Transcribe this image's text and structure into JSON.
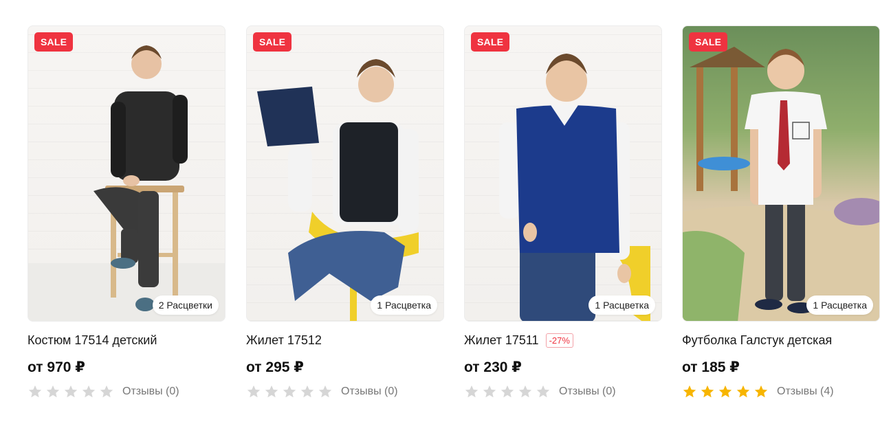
{
  "colors": {
    "sale": "#ef3340",
    "star_filled": "#f7b500",
    "star_empty": "#d6d6d6"
  },
  "products": [
    {
      "badge": "SALE",
      "colors_label": "2 Расцветки",
      "title": "Костюм 17514 детский",
      "discount": "",
      "price": "от 970 ₽",
      "rating": 0,
      "reviews": "Отзывы (0)"
    },
    {
      "badge": "SALE",
      "colors_label": "1 Расцветка",
      "title": "Жилет 17512",
      "discount": "",
      "price": "от 295 ₽",
      "rating": 0,
      "reviews": "Отзывы (0)"
    },
    {
      "badge": "SALE",
      "colors_label": "1 Расцветка",
      "title": "Жилет 17511",
      "discount": "-27%",
      "price": "от 230 ₽",
      "rating": 0,
      "reviews": "Отзывы (0)"
    },
    {
      "badge": "SALE",
      "colors_label": "1 Расцветка",
      "title": "Футболка Галстук детская",
      "discount": "",
      "price": "от 185 ₽",
      "rating": 5,
      "reviews": "Отзывы (4)"
    }
  ]
}
